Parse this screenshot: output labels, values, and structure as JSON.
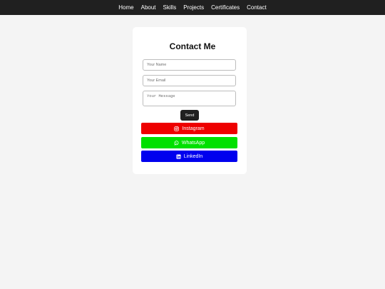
{
  "nav": {
    "items": [
      {
        "label": "Home"
      },
      {
        "label": "About"
      },
      {
        "label": "Skills"
      },
      {
        "label": "Projects"
      },
      {
        "label": "Certificates"
      },
      {
        "label": "Contact"
      }
    ]
  },
  "contact": {
    "title": "Contact Me",
    "name_placeholder": "Your Name",
    "email_placeholder": "Your Email",
    "message_placeholder": "Your Message",
    "send_label": "Send",
    "social": [
      {
        "label": "Instagram",
        "color": "#ee0000",
        "icon": "instagram-icon"
      },
      {
        "label": "WhatsApp",
        "color": "#00e000",
        "icon": "whatsapp-icon"
      },
      {
        "label": "LinkedIn",
        "color": "#0000ee",
        "icon": "linkedin-icon"
      }
    ]
  }
}
